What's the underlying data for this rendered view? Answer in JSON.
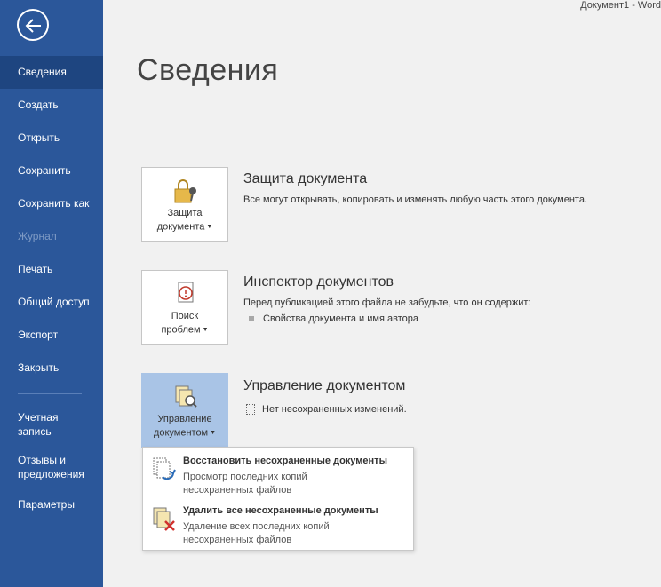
{
  "window": {
    "title": "Документ1  -  Word"
  },
  "sidebar": {
    "items": [
      {
        "label": "Сведения"
      },
      {
        "label": "Создать"
      },
      {
        "label": "Открыть"
      },
      {
        "label": "Сохранить"
      },
      {
        "label": "Сохранить как"
      },
      {
        "label": "Журнал"
      },
      {
        "label": "Печать"
      },
      {
        "label": "Общий доступ"
      },
      {
        "label": "Экспорт"
      },
      {
        "label": "Закрыть"
      }
    ],
    "account": {
      "line1": "Учетная",
      "line2": "запись"
    },
    "feedback": {
      "line1": "Отзывы и",
      "line2": "предложения"
    },
    "options": {
      "label": "Параметры"
    }
  },
  "main": {
    "title": "Сведения",
    "protect": {
      "btn_line1": "Защита",
      "btn_line2": "документа",
      "title": "Защита документа",
      "desc": "Все могут открывать, копировать и изменять любую часть этого документа."
    },
    "inspect": {
      "btn_line1": "Поиск",
      "btn_line2": "проблем",
      "title": "Инспектор документов",
      "desc": "Перед публикацией этого файла не забудьте, что он содержит:",
      "bullet": "Свойства документа и имя автора"
    },
    "manage": {
      "btn_line1": "Управление",
      "btn_line2": "документом",
      "title": "Управление документом",
      "desc": "Нет несохраненных изменений."
    }
  },
  "dropdown": {
    "items": [
      {
        "title": "Восстановить несохраненные документы",
        "sub1": "Просмотр последних копий",
        "sub2": "несохраненных файлов"
      },
      {
        "title": "Удалить все несохраненные документы",
        "sub1": "Удаление всех последних копий",
        "sub2": "несохраненных файлов"
      }
    ]
  },
  "colors": {
    "sidebar": "#2b579a",
    "sidebar_active": "#1e4580",
    "active_button": "#a9c4e6"
  }
}
